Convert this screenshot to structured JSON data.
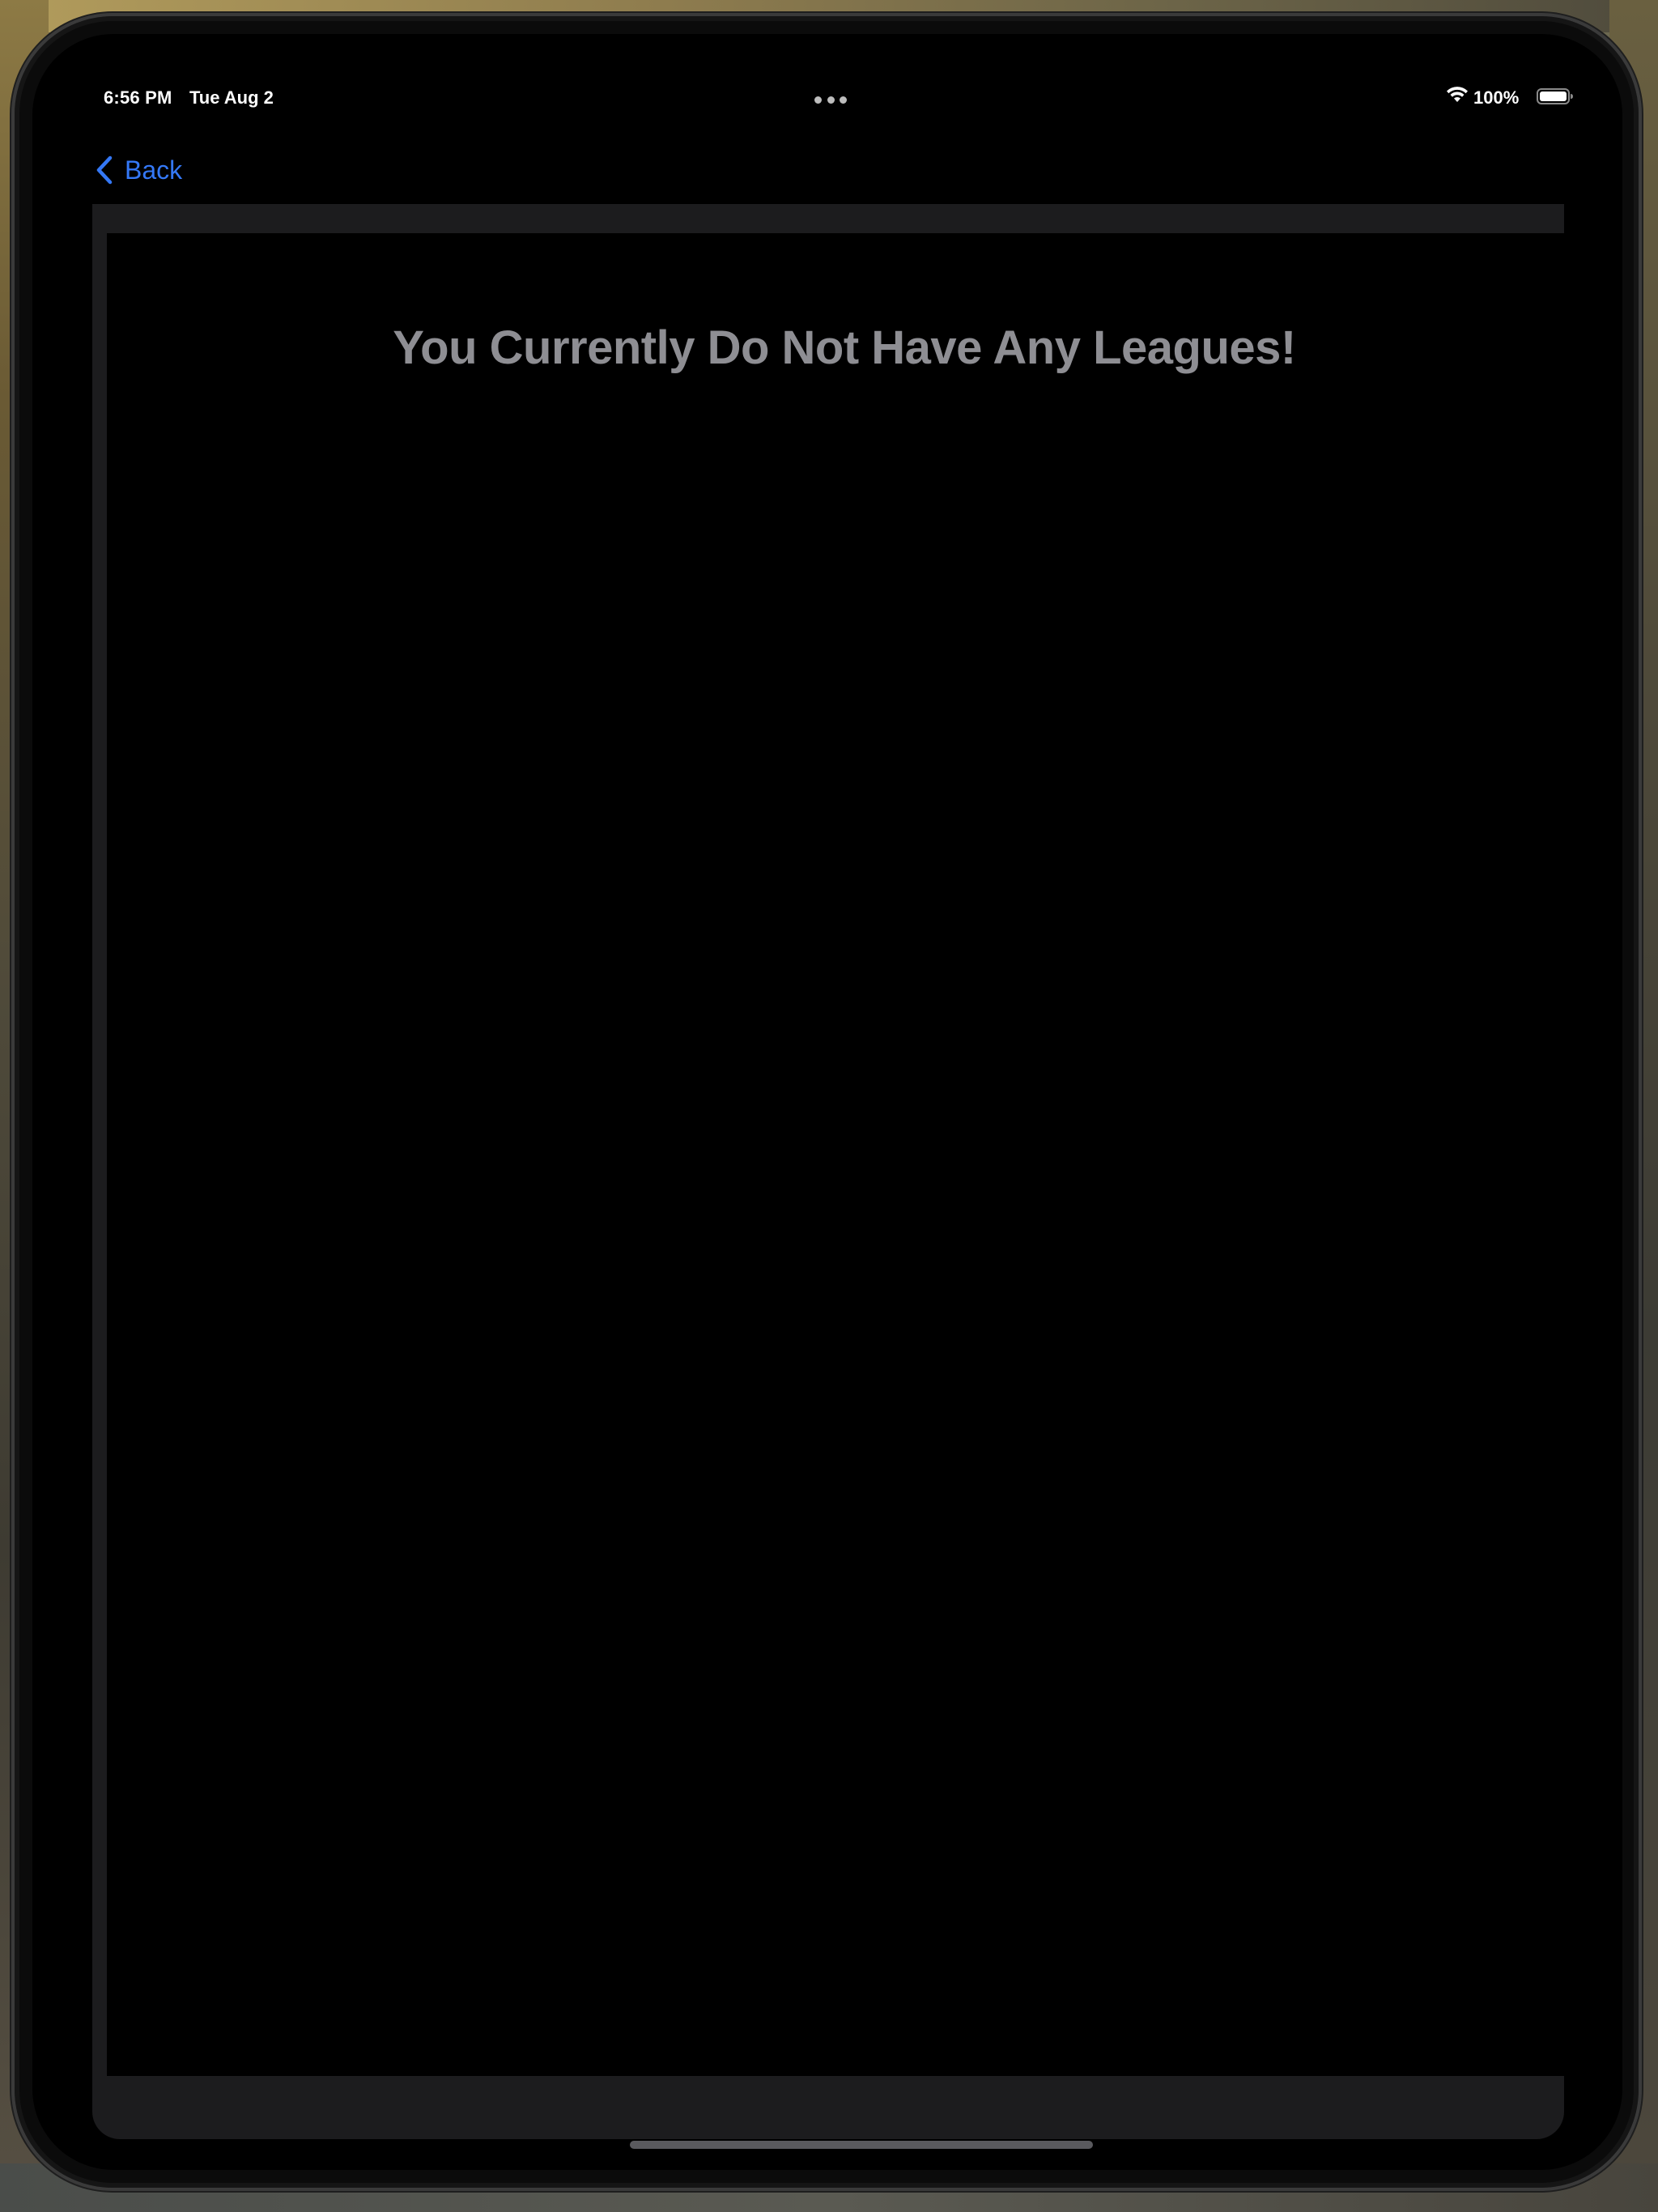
{
  "status_bar": {
    "time": "6:56 PM",
    "date": "Tue Aug 2",
    "battery_percent": "100%",
    "battery_level": 1.0,
    "wifi_icon": "wifi-icon",
    "battery_icon": "battery-icon"
  },
  "nav": {
    "back_label": "Back",
    "back_icon": "chevron-left-icon"
  },
  "main": {
    "empty_message": "You Currently Do Not Have Any Leagues!"
  },
  "colors": {
    "accent": "#3478f6",
    "background": "#000000",
    "sheet_background": "#1c1c1e",
    "empty_text": "#8e8e93"
  }
}
